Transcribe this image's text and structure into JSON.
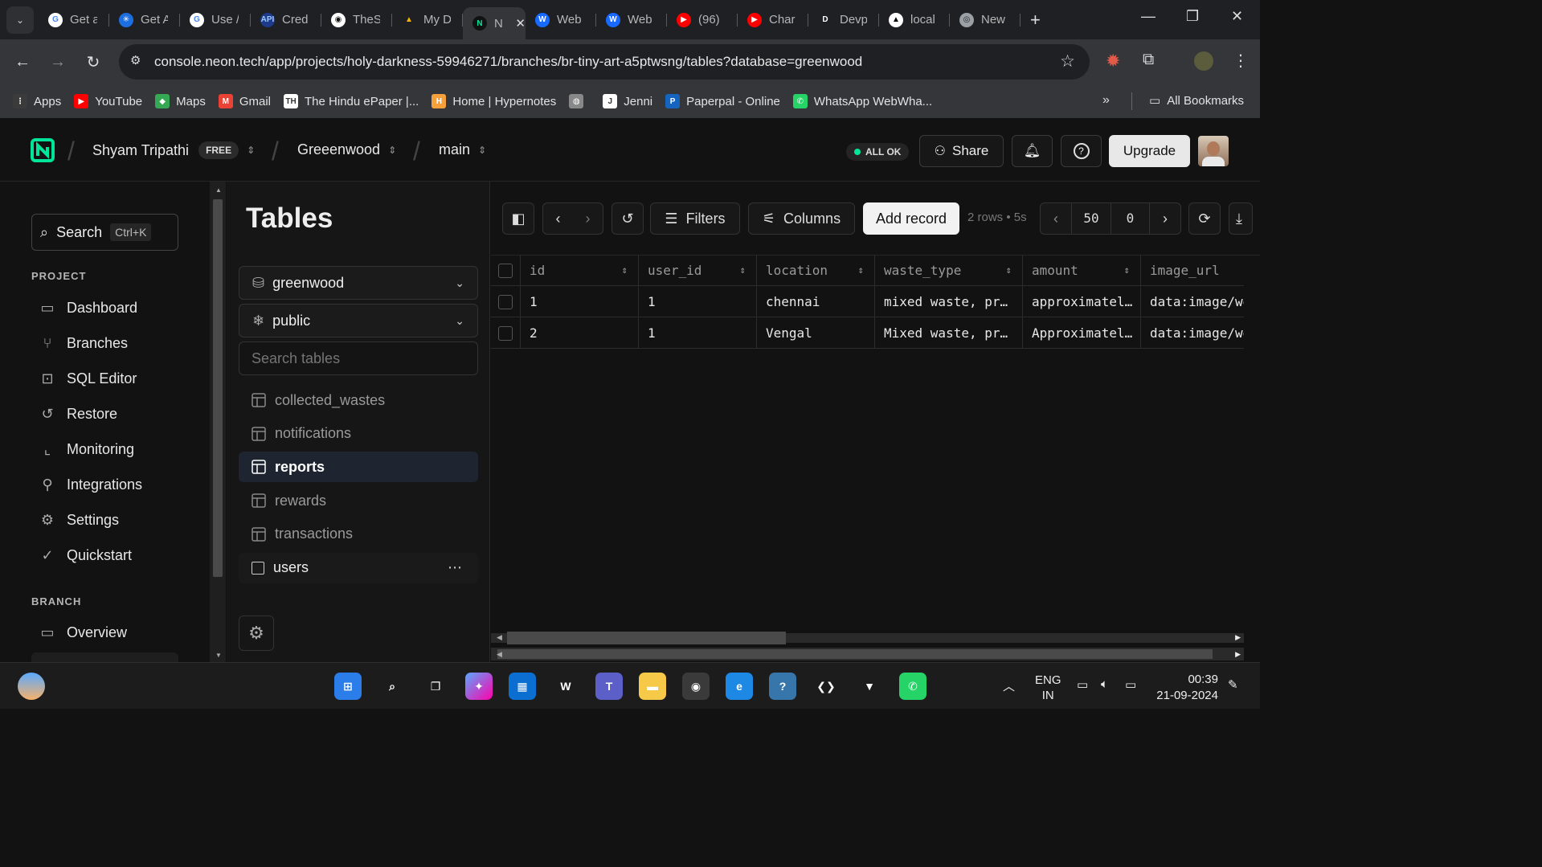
{
  "browser": {
    "tabs": [
      {
        "title": "Get a",
        "fav": "G",
        "color": "#ffffff",
        "fg": "#4285f4"
      },
      {
        "title": "Get A",
        "fav": "✳",
        "color": "#1d6fe0",
        "fg": "#fff"
      },
      {
        "title": "Use /",
        "fav": "G",
        "color": "#ffffff",
        "fg": "#4285f4"
      },
      {
        "title": "Cred",
        "fav": "API",
        "color": "#1e3a8a",
        "fg": "#9ecbff"
      },
      {
        "title": "TheS",
        "fav": "◉",
        "color": "#ffffff",
        "fg": "#111"
      },
      {
        "title": "My D",
        "fav": "▲",
        "color": "#1f2024",
        "fg": "#f4b400"
      },
      {
        "title": "N",
        "fav": "N",
        "color": "#0f1412",
        "fg": "#00e599"
      },
      {
        "title": "Web",
        "fav": "W",
        "color": "#1769ff",
        "fg": "#fff"
      },
      {
        "title": "Web",
        "fav": "W",
        "color": "#1769ff",
        "fg": "#fff"
      },
      {
        "title": "(96)",
        "fav": "▶",
        "color": "#ff0000",
        "fg": "#fff"
      },
      {
        "title": "Char",
        "fav": "▶",
        "color": "#ff0000",
        "fg": "#fff"
      },
      {
        "title": "Devp",
        "fav": "D",
        "color": "#1f2024",
        "fg": "#fff"
      },
      {
        "title": "local",
        "fav": "▲",
        "color": "#ffffff",
        "fg": "#000"
      },
      {
        "title": "New",
        "fav": "◎",
        "color": "#9aa0a6",
        "fg": "#1f2024"
      }
    ],
    "url": "console.neon.tech/app/projects/holy-darkness-59946271/branches/br-tiny-art-a5ptwsng/tables?database=greenwood",
    "bookmarks": [
      {
        "label": "Apps",
        "fav": "⋮",
        "color": "#3b3b3b"
      },
      {
        "label": "YouTube",
        "fav": "▶",
        "color": "#ff0000"
      },
      {
        "label": "Maps",
        "fav": "◆",
        "color": "#34a853"
      },
      {
        "label": "Gmail",
        "fav": "M",
        "color": "#ea4335"
      },
      {
        "label": "The Hindu ePaper |...",
        "fav": "TH",
        "color": "#ffffff"
      },
      {
        "label": "Home | Hypernotes",
        "fav": "H",
        "color": "#f6a03b"
      },
      {
        "label": "",
        "fav": "◍",
        "color": "#888888"
      },
      {
        "label": "Jenni",
        "fav": "J",
        "color": "#ffffff"
      },
      {
        "label": "Paperpal - Online",
        "fav": "P",
        "color": "#1565c0"
      },
      {
        "label": "WhatsApp WebWha...",
        "fav": "✆",
        "color": "#25d366"
      }
    ],
    "all_bookmarks": "All Bookmarks"
  },
  "header": {
    "user": "Shyam Tripathi",
    "plan": "FREE",
    "project": "Greeenwood",
    "branch": "main",
    "status": "ALL OK",
    "share": "Share",
    "upgrade": "Upgrade"
  },
  "sidebar": {
    "search": "Search",
    "shortcut": "Ctrl+K",
    "project_label": "PROJECT",
    "items": [
      {
        "label": "Dashboard",
        "icon": "dashboard-icon"
      },
      {
        "label": "Branches",
        "icon": "branches-icon"
      },
      {
        "label": "SQL Editor",
        "icon": "sql-editor-icon"
      },
      {
        "label": "Restore",
        "icon": "restore-icon"
      },
      {
        "label": "Monitoring",
        "icon": "monitoring-icon"
      },
      {
        "label": "Integrations",
        "icon": "integrations-icon"
      },
      {
        "label": "Settings",
        "icon": "settings-icon"
      },
      {
        "label": "Quickstart",
        "icon": "quickstart-icon"
      }
    ],
    "branch_label": "BRANCH",
    "branch_items": [
      {
        "label": "Overview",
        "icon": "overview-icon"
      }
    ]
  },
  "tables": {
    "title": "Tables",
    "database": "greenwood",
    "schema": "public",
    "search_placeholder": "Search tables",
    "items": [
      "collected_wastes",
      "notifications",
      "reports",
      "rewards",
      "transactions",
      "users"
    ],
    "active": "reports"
  },
  "toolbar": {
    "filters": "Filters",
    "columns": "Columns",
    "add_record": "Add record",
    "meta": "2 rows • 5s",
    "limit": "50",
    "offset": "0"
  },
  "grid": {
    "columns": [
      "id",
      "user_id",
      "location",
      "waste_type",
      "amount",
      "image_url"
    ],
    "rows": [
      [
        "1",
        "1",
        "chennai",
        "mixed waste, pr…",
        "approximatel…",
        "data:image/we"
      ],
      [
        "2",
        "1",
        "Vengal",
        "Mixed waste, pr…",
        "Approximatel…",
        "data:image/we"
      ]
    ]
  },
  "taskbar": {
    "lang": "ENG",
    "region": "IN",
    "time": "00:39",
    "date": "21-09-2024"
  }
}
